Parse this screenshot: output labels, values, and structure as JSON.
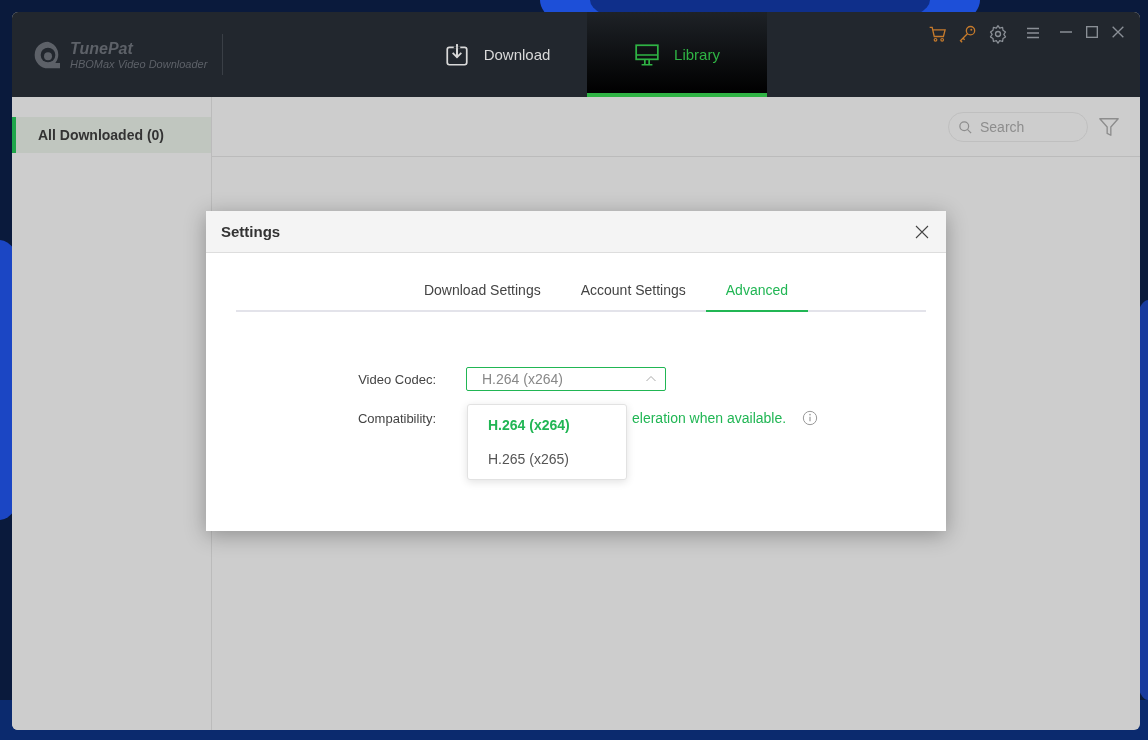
{
  "app": {
    "name": "TunePat",
    "subtitle": "HBOMax Video Downloader"
  },
  "nav_tabs": [
    {
      "label": "Download",
      "selected": false
    },
    {
      "label": "Library",
      "selected": true
    }
  ],
  "sidebar": {
    "items": [
      {
        "label": "All Downloaded (0)",
        "selected": true
      }
    ]
  },
  "search": {
    "placeholder": "Search"
  },
  "dialog": {
    "title": "Settings",
    "tabs": [
      {
        "label": "Download Settings",
        "selected": false
      },
      {
        "label": "Account Settings",
        "selected": false
      },
      {
        "label": "Advanced",
        "selected": true
      }
    ],
    "fields": [
      {
        "kind": "select",
        "label": "Video Codec:",
        "value": "H.264 (x264)",
        "expanded": true,
        "options": [
          {
            "label": "H.264 (x264)",
            "selected": true
          },
          {
            "label": "H.265 (x265)",
            "selected": false
          }
        ]
      },
      {
        "kind": "note",
        "label": "Compatibility:",
        "text": "eleration when available."
      }
    ]
  }
}
